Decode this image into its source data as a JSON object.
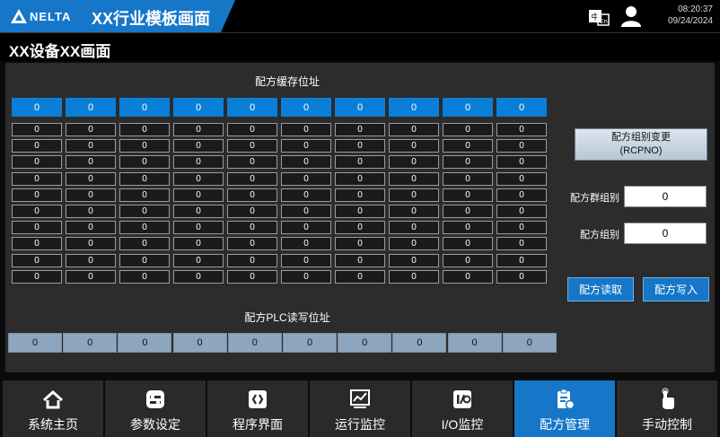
{
  "header": {
    "logo_text": "NELTA",
    "app_title": "XX行业模板画面",
    "time": "08:20:37",
    "date": "09/24/2024"
  },
  "page": {
    "title": "XX设备XX画面"
  },
  "recipe_buffer": {
    "label": "配方缓存位址",
    "header_values": [
      "0",
      "0",
      "0",
      "0",
      "0",
      "0",
      "0",
      "0",
      "0",
      "0"
    ],
    "rows": [
      [
        "0",
        "0",
        "0",
        "0",
        "0",
        "0",
        "0",
        "0",
        "0",
        "0"
      ],
      [
        "0",
        "0",
        "0",
        "0",
        "0",
        "0",
        "0",
        "0",
        "0",
        "0"
      ],
      [
        "0",
        "0",
        "0",
        "0",
        "0",
        "0",
        "0",
        "0",
        "0",
        "0"
      ],
      [
        "0",
        "0",
        "0",
        "0",
        "0",
        "0",
        "0",
        "0",
        "0",
        "0"
      ],
      [
        "0",
        "0",
        "0",
        "0",
        "0",
        "0",
        "0",
        "0",
        "0",
        "0"
      ],
      [
        "0",
        "0",
        "0",
        "0",
        "0",
        "0",
        "0",
        "0",
        "0",
        "0"
      ],
      [
        "0",
        "0",
        "0",
        "0",
        "0",
        "0",
        "0",
        "0",
        "0",
        "0"
      ],
      [
        "0",
        "0",
        "0",
        "0",
        "0",
        "0",
        "0",
        "0",
        "0",
        "0"
      ],
      [
        "0",
        "0",
        "0",
        "0",
        "0",
        "0",
        "0",
        "0",
        "0",
        "0"
      ],
      [
        "0",
        "0",
        "0",
        "0",
        "0",
        "0",
        "0",
        "0",
        "0",
        "0"
      ]
    ]
  },
  "plc_rw": {
    "label": "配方PLC读写位址",
    "values": [
      "0",
      "0",
      "0",
      "0",
      "0",
      "0",
      "0",
      "0",
      "0",
      "0"
    ]
  },
  "controls": {
    "rcpno_button_line1": "配方组别变更",
    "rcpno_button_line2": "(RCPNO)",
    "group_label": "配方群组别",
    "group_value": "0",
    "recipe_group_label": "配方组别",
    "recipe_group_value": "0",
    "read_button": "配方读取",
    "write_button": "配方写入"
  },
  "nav": {
    "items": [
      {
        "label": "系统主页",
        "icon": "home-icon"
      },
      {
        "label": "参数设定",
        "icon": "settings-toggle-icon"
      },
      {
        "label": "程序界面",
        "icon": "program-brackets-icon"
      },
      {
        "label": "运行监控",
        "icon": "chart-monitor-icon"
      },
      {
        "label": "I/O监控",
        "icon": "io-monitor-icon"
      },
      {
        "label": "配方管理",
        "icon": "recipe-clipboard-icon"
      },
      {
        "label": "手动控制",
        "icon": "hand-pointer-icon"
      }
    ],
    "active_index": 5
  },
  "colors": {
    "accent": "#1677c8",
    "panel_bg": "#2c2c2c",
    "plc_cell_bg": "#8ea6bd"
  }
}
